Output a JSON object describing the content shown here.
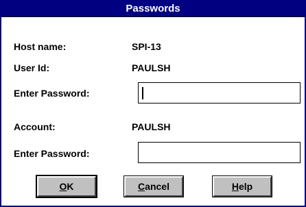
{
  "dialog": {
    "title": "Passwords",
    "host_label": "Host name:",
    "host_value": "SPI-13",
    "user_label": "User Id:",
    "user_value": "PAULSH",
    "password1_label": "Enter Password:",
    "password1_value": "",
    "account_label": "Account:",
    "account_value": "PAULSH",
    "password2_label": "Enter Password:",
    "password2_value": ""
  },
  "buttons": {
    "ok": {
      "mnemonic": "O",
      "rest": "K"
    },
    "cancel": {
      "mnemonic": "C",
      "rest": "ancel"
    },
    "help": {
      "mnemonic": "H",
      "rest": "elp"
    }
  },
  "colors": {
    "titlebar": "#000080",
    "button_face": "#c0c0c0"
  }
}
